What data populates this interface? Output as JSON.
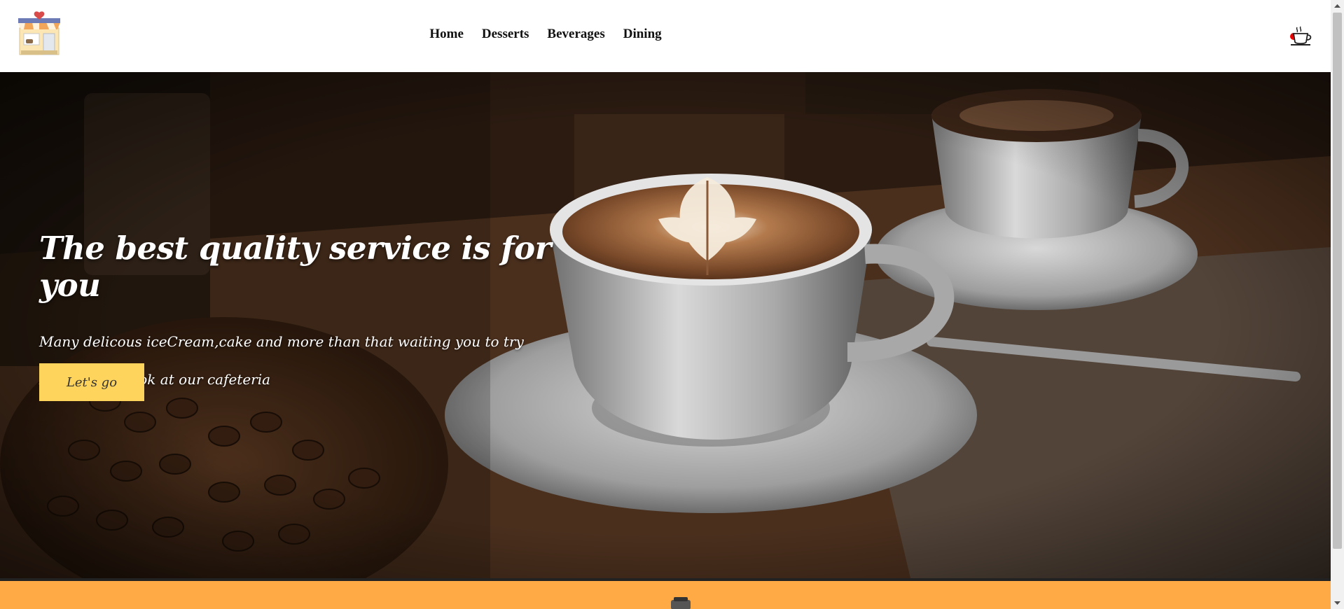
{
  "nav": {
    "links": [
      "Home",
      "Desserts",
      "Beverages",
      "Dining"
    ],
    "logo_icon": "shop-logo-icon",
    "cart_icon": "coffee-cup-icon"
  },
  "hero": {
    "title": "The best quality service is for you",
    "subtitle": "Many delicous iceCream,cake and more than that waiting you to try",
    "subtitle2": "Let's take a look at our cafeteria",
    "cta_label": "Let's go"
  },
  "colors": {
    "nav_bg": "#ffffff",
    "cta_bg": "#ffd45c",
    "strip_bg": "#ffaa44",
    "badge": "#ee0000"
  }
}
